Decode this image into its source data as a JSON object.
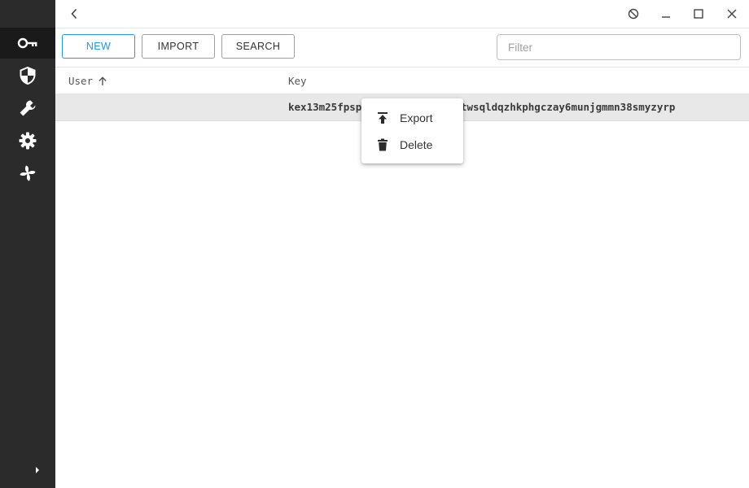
{
  "sidebar": {
    "items": [
      {
        "name": "keys",
        "icon": "key-icon",
        "active": true
      },
      {
        "name": "security",
        "icon": "shield-icon",
        "active": false
      },
      {
        "name": "tools",
        "icon": "wrench-icon",
        "active": false
      },
      {
        "name": "settings",
        "icon": "gear-icon",
        "active": false
      },
      {
        "name": "network",
        "icon": "pinwheel-icon",
        "active": false
      }
    ],
    "expand_icon": "chevron-right-icon"
  },
  "titlebar": {
    "back_icon": "chevron-left-icon",
    "window_controls": [
      "block-icon",
      "minimize-icon",
      "maximize-icon",
      "close-icon"
    ]
  },
  "toolbar": {
    "new_label": "NEW",
    "import_label": "IMPORT",
    "search_label": "SEARCH",
    "filter_placeholder": "Filter",
    "filter_value": ""
  },
  "table": {
    "columns": [
      {
        "label": "User",
        "sort": "ascending"
      },
      {
        "label": "Key"
      }
    ],
    "rows": [
      {
        "user": "",
        "key": "kex13m25fpsp",
        "key_tail": "twsqldqzhkphgczay6munjgmmn38smyzyrp"
      }
    ]
  },
  "context_menu": {
    "items": [
      {
        "label": "Export",
        "icon": "upload-icon"
      },
      {
        "label": "Delete",
        "icon": "trash-icon"
      }
    ]
  },
  "colors": {
    "sidebar_bg": "#2b2b2b",
    "sidebar_active": "#1a1a1a",
    "accent": "#2196f3",
    "row_selected": "#e8e8e8"
  }
}
